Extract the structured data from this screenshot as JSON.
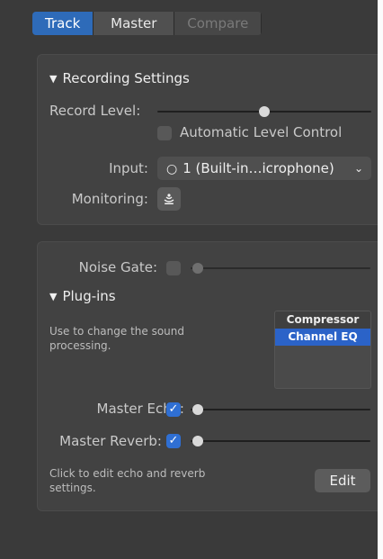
{
  "tabs": {
    "track": "Track",
    "master": "Master",
    "compare": "Compare"
  },
  "recording": {
    "title": "Recording Settings",
    "record_level_label": "Record Level:",
    "record_level_value": 0.5,
    "auto_level_label": "Automatic Level Control",
    "auto_level_checked": false,
    "input_label": "Input:",
    "input_value": "1 (Built-in…icrophone)",
    "monitoring_label": "Monitoring:"
  },
  "master": {
    "noise_gate_label": "Noise Gate:",
    "noise_gate_checked": false,
    "plugins_title": "Plug-ins",
    "plugins_desc_line1": "Use to change the sound",
    "plugins_desc_line2": "processing.",
    "plugins": [
      {
        "name": "Compressor",
        "selected": false
      },
      {
        "name": "Channel EQ",
        "selected": true
      }
    ],
    "master_echo_label": "Master Echo:",
    "master_echo_checked": true,
    "master_reverb_label": "Master Reverb:",
    "master_reverb_checked": true,
    "edit_desc_line1": "Click to edit echo and reverb",
    "edit_desc_line2": "settings.",
    "edit_label": "Edit"
  },
  "icons": {
    "disclosure": "triangle-down-icon",
    "input_ring": "circle-outline-icon",
    "chevron": "chevron-down-icon",
    "monitoring": "monitoring-icon"
  },
  "colors": {
    "accent": "#2e6bb9",
    "panel": "#3a3a3a",
    "section": "#424242",
    "selected": "#2b63c8"
  }
}
